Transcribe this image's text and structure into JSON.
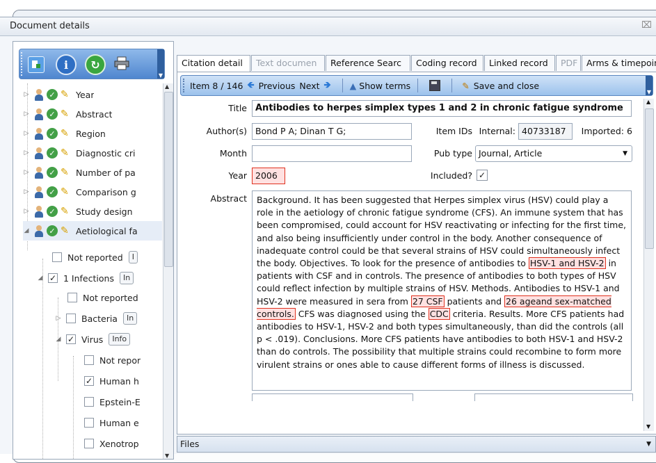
{
  "window": {
    "title": "Document details",
    "close_glyph": "⌧"
  },
  "toolbar_left": {
    "icons": [
      "add-document-icon",
      "info-icon",
      "refresh-icon",
      "print-icon"
    ]
  },
  "tree": {
    "items": [
      {
        "label": "Year"
      },
      {
        "label": "Abstract"
      },
      {
        "label": "Region"
      },
      {
        "label": "Diagnostic cri"
      },
      {
        "label": "Number of pa"
      },
      {
        "label": "Comparison g"
      },
      {
        "label": "Study design"
      },
      {
        "label": "Aetiological fa"
      }
    ],
    "sub_items": [
      {
        "label": "Not reported",
        "checked": false,
        "info": "I"
      },
      {
        "label": "1 Infections",
        "checked": true,
        "info": "In"
      },
      {
        "label": "Not reported",
        "checked": false,
        "info": ""
      },
      {
        "label": "Bacteria",
        "checked": false,
        "info": "In"
      },
      {
        "label": "Virus",
        "checked": true,
        "info": "Info"
      },
      {
        "label": "Not repor",
        "checked": false,
        "info": ""
      },
      {
        "label": "Human h",
        "checked": true,
        "info": ""
      },
      {
        "label": "Epstein-E",
        "checked": false,
        "info": ""
      },
      {
        "label": "Human e",
        "checked": false,
        "info": ""
      },
      {
        "label": "Xenotrop",
        "checked": false,
        "info": ""
      }
    ],
    "checkmark": "✓"
  },
  "tabs": [
    {
      "label": "Citation detail",
      "state": "active"
    },
    {
      "label": "Text documen",
      "state": "disabled"
    },
    {
      "label": "Reference Searc",
      "state": "normal"
    },
    {
      "label": "Coding record",
      "state": "normal"
    },
    {
      "label": "Linked record",
      "state": "normal"
    },
    {
      "label": "PDF",
      "state": "disabled"
    },
    {
      "label": "Arms & timepoint",
      "state": "normal"
    }
  ],
  "item_toolbar": {
    "item_position": "Item 8 / 146",
    "previous_label": "Previous",
    "next_label": "Next",
    "show_terms_label": "Show terms",
    "save_close_label": "Save and close"
  },
  "form": {
    "title_label": "Title",
    "title_value": "Antibodies to herpes simplex types 1 and 2 in chronic fatigue syndrome",
    "authors_label": "Author(s)",
    "authors_value": "Bond P A; Dinan T G;",
    "item_ids_label": "Item IDs",
    "internal_label": "Internal:",
    "internal_value": "40733187",
    "imported_label": "Imported:",
    "imported_value": "6",
    "month_label": "Month",
    "month_value": "",
    "pub_type_label": "Pub type",
    "pub_type_value": "Journal, Article",
    "year_label": "Year",
    "year_value": "2006",
    "included_label": "Included?",
    "included_checked": true,
    "abstract_label": "Abstract",
    "abstract_parts": [
      {
        "text": "Background. It has been suggested that Herpes simplex virus (HSV) could play a role in the aetiology of chronic fatigue syndrome (CFS). An immune system that has been compromised, could account for HSV reactivating or infecting for the first time, and also being insufficiently under control in the body. Another consequence of inadequate control could be that several strains of HSV could simultaneously infect the body. Objectives. To look for the presence of antibodies to ",
        "highlight": false
      },
      {
        "text": "HSV-1 and HSV-2",
        "highlight": true
      },
      {
        "text": " in patients with CSF and in controls. The presence of antibodies to both types of HSV could reflect infection by multiple strains of HSV. Methods. Antibodies to HSV-1 and HSV-2 were measured in sera from ",
        "highlight": false
      },
      {
        "text": "27 CSF",
        "highlight": true
      },
      {
        "text": " patients and ",
        "highlight": false
      },
      {
        "text": "26 ageand sex-matched controls.",
        "highlight": true
      },
      {
        "text": " CFS was diagnosed using the ",
        "highlight": false
      },
      {
        "text": "CDC",
        "highlight": true
      },
      {
        "text": " criteria. Results. More CFS patients had antibodies to HSV-1, HSV-2 and both types simultaneously, than did the controls (all p < .019). Conclusions. More CFS patients have antibodies to both HSV-1 and HSV-2 than do controls. The possibility that multiple strains could recombine to form more virulent strains or ones able to cause different forms of illness is discussed.",
        "highlight": false
      }
    ]
  },
  "files_bar": {
    "label": "Files"
  },
  "colors": {
    "toolbar_blue": "#4f86cf",
    "highlight_border": "#e0301e",
    "highlight_fill": "#ffe1e1",
    "ok_green": "#43a047"
  }
}
